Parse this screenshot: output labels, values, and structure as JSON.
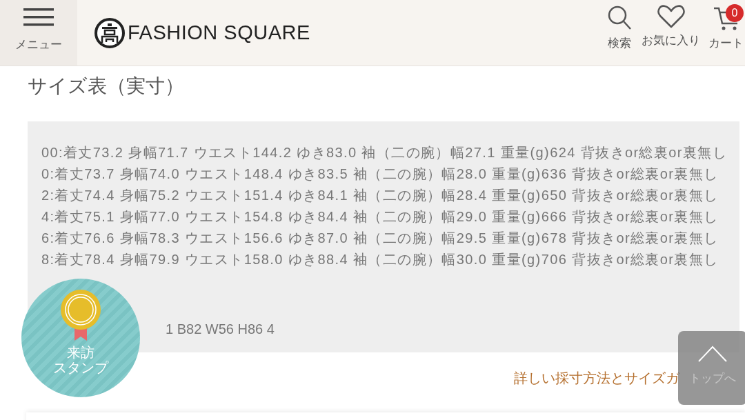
{
  "header": {
    "menu_label": "メニュー",
    "logo_text": "FASHION SQUARE",
    "actions": [
      {
        "kind": "search",
        "label": "検索"
      },
      {
        "kind": "favorite",
        "label": "お気に入り"
      },
      {
        "kind": "cart",
        "label": "カート",
        "badge": "0"
      }
    ]
  },
  "title": "サイズ表（実寸）",
  "size_rows": [
    "00:着丈73.2 身幅71.7 ウエスト144.2 ゆき83.0 袖（二の腕）幅27.1 重量(g)624 背抜きor総裏or裏無し",
    "0:着丈73.7 身幅74.0 ウエスト148.4 ゆき83.5 袖（二の腕）幅28.0 重量(g)636 背抜きor総裏or裏無し",
    "2:着丈74.4 身幅75.2 ウエスト151.4 ゆき84.1 袖（二の腕）幅28.4 重量(g)650 背抜きor総裏or裏無し",
    "4:着丈75.1 身幅77.0 ウエスト154.8 ゆき84.4 袖（二の腕）幅29.0 重量(g)666 背抜きor総裏or裏無し",
    "6:着丈76.6 身幅78.3 ウエスト156.6 ゆき87.0 袖（二の腕）幅29.5 重量(g)678 背抜きor総裏or裏無し",
    "8:着丈78.4 身幅79.9 ウエスト158.0 ゆき88.4 袖（二の腕）幅30.0 重量(g)706 背抜きor総裏or裏無し"
  ],
  "model_line": "1 B82 W56 H86 4",
  "guide_link": "詳しい採寸方法とサイズガ",
  "stamp": {
    "lines": [
      "来訪",
      "スタンプ"
    ]
  },
  "top_button": {
    "label": "トップへ"
  }
}
